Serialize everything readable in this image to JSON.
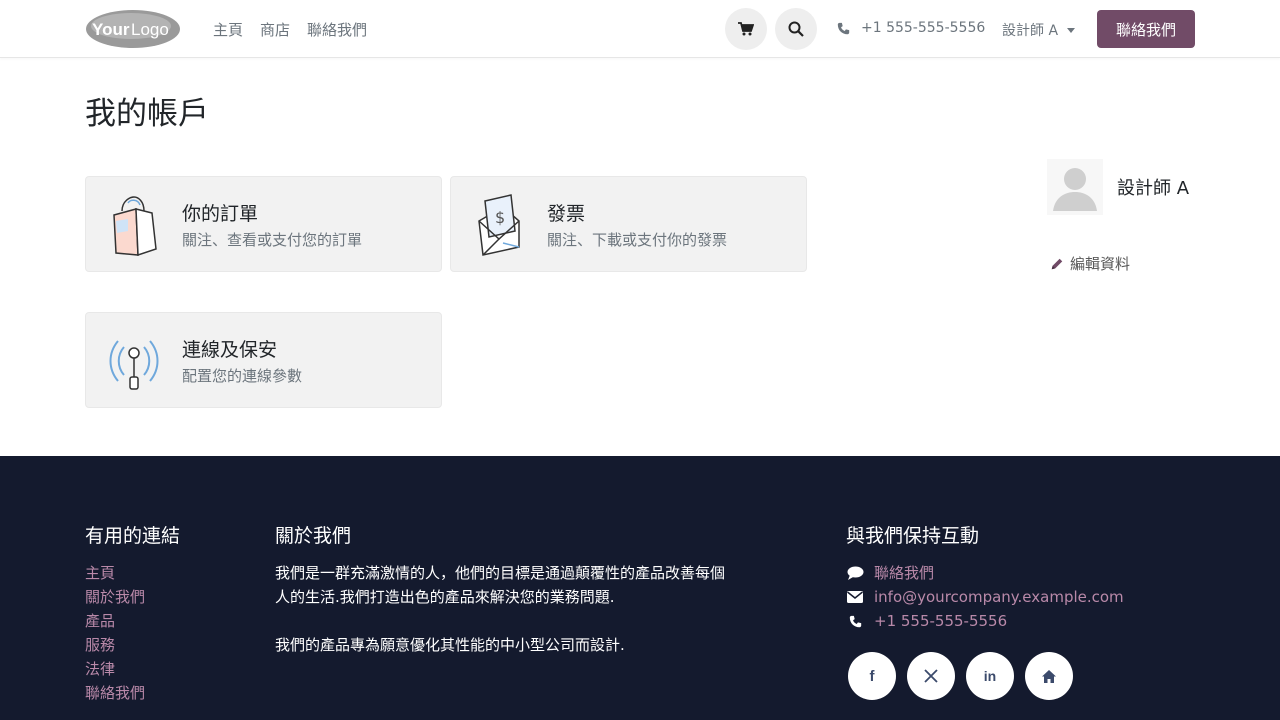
{
  "header": {
    "logo_text": "YourLogo",
    "nav": [
      "主頁",
      "商店",
      "聯絡我們"
    ],
    "phone": "+1 555-555-5556",
    "user_menu": "設計師 A",
    "contact_button": "聯絡我們"
  },
  "main": {
    "title": "我的帳戶",
    "cards": [
      {
        "title": "你的訂單",
        "subtitle": "關注、查看或支付您的訂單",
        "icon": "shopping-bag-icon"
      },
      {
        "title": "發票",
        "subtitle": "關注、下載或支付你的發票",
        "icon": "invoice-envelope-icon"
      },
      {
        "title": "連線及保安",
        "subtitle": "配置您的連線參數",
        "icon": "antenna-icon"
      }
    ],
    "profile": {
      "name": "設計師 A",
      "edit_label": "編輯資料"
    }
  },
  "footer": {
    "useful_links_title": "有用的連結",
    "links": [
      "主頁",
      "關於我們",
      "產品",
      "服務",
      "法律",
      "聯絡我們"
    ],
    "about_title": "關於我們",
    "about_paragraphs": [
      "我們是一群充滿激情的人，他們的目標是通過顛覆性的產品改善每個人的生活.我們打造出色的產品來解決您的業務問題.",
      "我們的產品專為願意優化其性能的中小型公司而設計."
    ],
    "connect_title": "與我們保持互動",
    "contact_us": "聯絡我們",
    "email": "info@yourcompany.example.com",
    "phone": "+1 555-555-5556",
    "social": [
      "facebook-icon",
      "x-twitter-icon",
      "linkedin-icon",
      "home-icon"
    ]
  },
  "colors": {
    "brand": "#714b67",
    "footer_bg": "#141a2e",
    "footer_link": "#b989a9",
    "card_bg": "#f2f2f2"
  }
}
